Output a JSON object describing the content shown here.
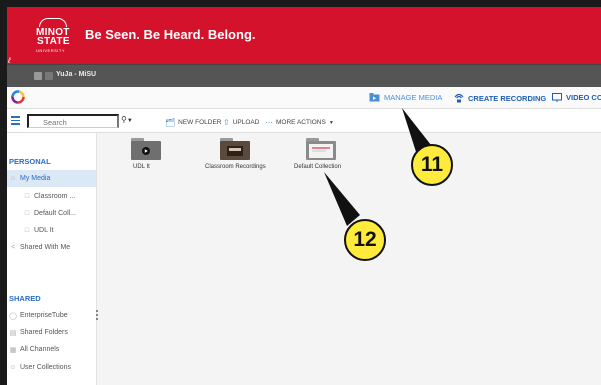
{
  "brand": {
    "logo_line1": "MINOT",
    "logo_line2": "STATE",
    "logo_line3": "UNIVERSITY",
    "tagline": "Be Seen. Be Heard. Belong.",
    "color": "#d4122c"
  },
  "browser_tab": {
    "title": "YuJa - MiSU"
  },
  "topnav": {
    "manage_media": "MANAGE MEDIA",
    "create_recording": "CREATE RECORDING",
    "video_con": "VIDEO CON"
  },
  "toolbar": {
    "search_placeholder": "Search",
    "new_folder": "NEW FOLDER",
    "upload": "UPLOAD",
    "more_actions": "MORE ACTIONS"
  },
  "sidebar": {
    "personal_heading": "PERSONAL",
    "personal_items": [
      {
        "label": "My Media",
        "icon": "home-icon",
        "active": true
      },
      {
        "label": "Classroom ...",
        "icon": "folder-icon"
      },
      {
        "label": "Default Coll...",
        "icon": "folder-icon"
      },
      {
        "label": "UDL It",
        "icon": "folder-icon"
      },
      {
        "label": "Shared With Me",
        "icon": "share-icon"
      }
    ],
    "shared_heading": "SHARED",
    "shared_items": [
      {
        "label": "EnterpriseTube",
        "icon": "globe-icon"
      },
      {
        "label": "Shared Folders",
        "icon": "folder-stack-icon"
      },
      {
        "label": "All Channels",
        "icon": "channels-icon"
      },
      {
        "label": "User Collections",
        "icon": "user-icon"
      }
    ]
  },
  "folders": [
    {
      "label": "UDL It",
      "thumb": "video-icon"
    },
    {
      "label": "Classroom Recordings",
      "thumb": "screen-thumbnail"
    },
    {
      "label": "Default Collection",
      "thumb": "doc-thumbnail"
    }
  ],
  "annotations": {
    "callout_a": "11",
    "callout_b": "12"
  },
  "colors": {
    "accent": "#2b6dbf",
    "callout_fill": "#ffeb3b"
  }
}
